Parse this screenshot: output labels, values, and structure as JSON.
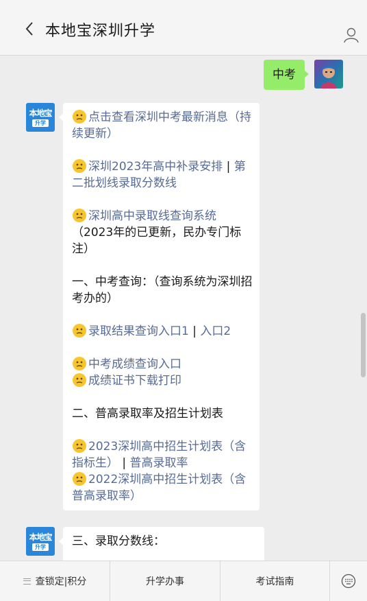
{
  "window": {
    "minimize_icon": "minimize-icon",
    "maximize_icon": "maximize-icon",
    "close_icon": "close-icon"
  },
  "header": {
    "title": "本地宝深圳升学",
    "back_icon": "chevron-left-icon",
    "profile_icon": "user-icon"
  },
  "messages": {
    "outgoing_text": "中考",
    "brand_avatar": {
      "top": "本地宝",
      "bottom": "升学"
    },
    "msg1": {
      "l1": "点击查看深圳中考最新消息（持续更新）",
      "l2": "深圳2023年高中补录安排",
      "l2_sep": "|",
      "l2b": "第二批划线录取分数线",
      "l3": "深圳高中录取线查询系统",
      "l3_note": "（2023年的已更新，民办专门标注）",
      "s1": "一、中考查询：（查询系统为深圳招考办的）",
      "l4a": "录取结果查询入口1",
      "l4_sep": "|",
      "l4b": "入口2",
      "l5": "中考成绩查询入口",
      "l6": "成绩证书下载打印",
      "s2": "二、普高录取率及招生计划表",
      "l7a": "2023深圳高中招生计划表（含指标生）",
      "l7_sep": "|",
      "l7b": "普高录取率",
      "l8": "2022深圳高中招生计划表（含普高录取率）"
    },
    "msg2": {
      "s3": "三、录取分数线："
    }
  },
  "menu": {
    "items": [
      "查锁定|积分",
      "升学办事",
      "考试指南"
    ],
    "keyboard_icon": "keyboard-icon"
  },
  "colors": {
    "link": "#576b95",
    "bubble_out": "#95ec69",
    "brand": "#2a86d8"
  }
}
